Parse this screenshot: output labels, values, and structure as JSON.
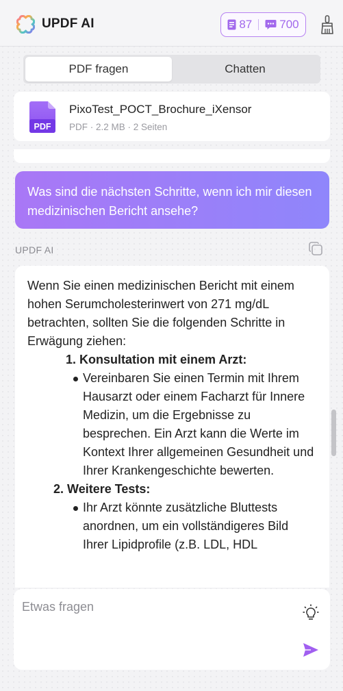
{
  "header": {
    "title": "UPDF AI",
    "pdf_quota": "87",
    "chat_quota": "700"
  },
  "tabs": [
    {
      "label": "PDF fragen",
      "active": true
    },
    {
      "label": "Chatten",
      "active": false
    }
  ],
  "file": {
    "name": "PixoTest_POCT_Brochure_iXensor",
    "meta": "PDF · 2.2 MB · 2 Seiten",
    "icon_label": "PDF"
  },
  "user_message": "Was sind die nächsten Schritte, wenn ich mir diesen medizinischen Bericht ansehe?",
  "ai_label": "UPDF AI",
  "answer": {
    "intro": "Wenn Sie einen medizinischen Bericht mit einem hohen Serumcholesterinwert von 271 mg/dL betrachten, sollten Sie die folgenden Schritte in Erwägung ziehen:",
    "steps": [
      {
        "number": "1.",
        "title": "Konsultation mit einem Arzt:",
        "bullet": "Vereinbaren Sie einen Termin mit Ihrem Hausarzt oder einem Facharzt für Innere Medizin, um die Ergebnisse zu besprechen. Ein Arzt kann die Werte im Kontext Ihrer allgemeinen Gesundheit und Ihrer Krankengeschichte bewerten."
      },
      {
        "number": "2.",
        "title": "Weitere Tests:",
        "bullet": "Ihr Arzt könnte zusätzliche Bluttests anordnen, um ein vollständigeres Bild Ihrer Lipidprofile (z.B. LDL, HDL"
      }
    ]
  },
  "input": {
    "placeholder": "Etwas fragen"
  },
  "colors": {
    "accent": "#a269ec",
    "bubble_start": "#a977f6",
    "bubble_end": "#8f86fb",
    "send": "#a15ff0"
  }
}
